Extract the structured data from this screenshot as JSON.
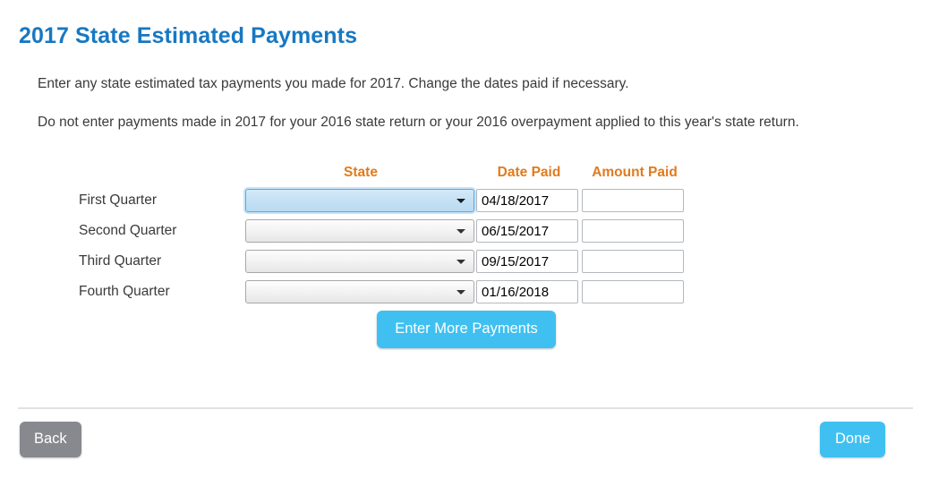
{
  "page": {
    "title": "2017 State Estimated Payments",
    "intro_1": "Enter any state estimated tax payments you made for 2017. Change the dates paid if necessary.",
    "intro_2": "Do not enter payments made in 2017 for your 2016 state return or your 2016 overpayment applied to this year's state return."
  },
  "table": {
    "headers": {
      "row_label": "",
      "state": "State",
      "date_paid": "Date Paid",
      "amount_paid": "Amount Paid"
    },
    "rows": [
      {
        "label": "First Quarter",
        "state_value": "",
        "state_focused": true,
        "date_value": "04/18/2017",
        "amount_value": "",
        "amount_placeholder": ""
      },
      {
        "label": "Second Quarter",
        "state_value": "",
        "state_focused": false,
        "date_value": "06/15/2017",
        "amount_value": "",
        "amount_placeholder": ""
      },
      {
        "label": "Third Quarter",
        "state_value": "",
        "state_focused": false,
        "date_value": "09/15/2017",
        "amount_value": "",
        "amount_placeholder": ""
      },
      {
        "label": "Fourth Quarter",
        "state_value": "",
        "state_focused": false,
        "date_value": "01/16/2018",
        "amount_value": "",
        "amount_placeholder": ""
      }
    ]
  },
  "actions": {
    "enter_more_payments": "Enter More Payments",
    "back": "Back",
    "done": "Done"
  },
  "icons": {
    "dropdown_arrow": "chevron-down-icon"
  },
  "colors": {
    "title_blue": "#1778c2",
    "header_orange": "#e07b1e",
    "primary_button": "#3fc0f0",
    "back_button": "#87898f",
    "focus_border": "#5aa9e0",
    "focus_fill": "#c3e0f4"
  }
}
